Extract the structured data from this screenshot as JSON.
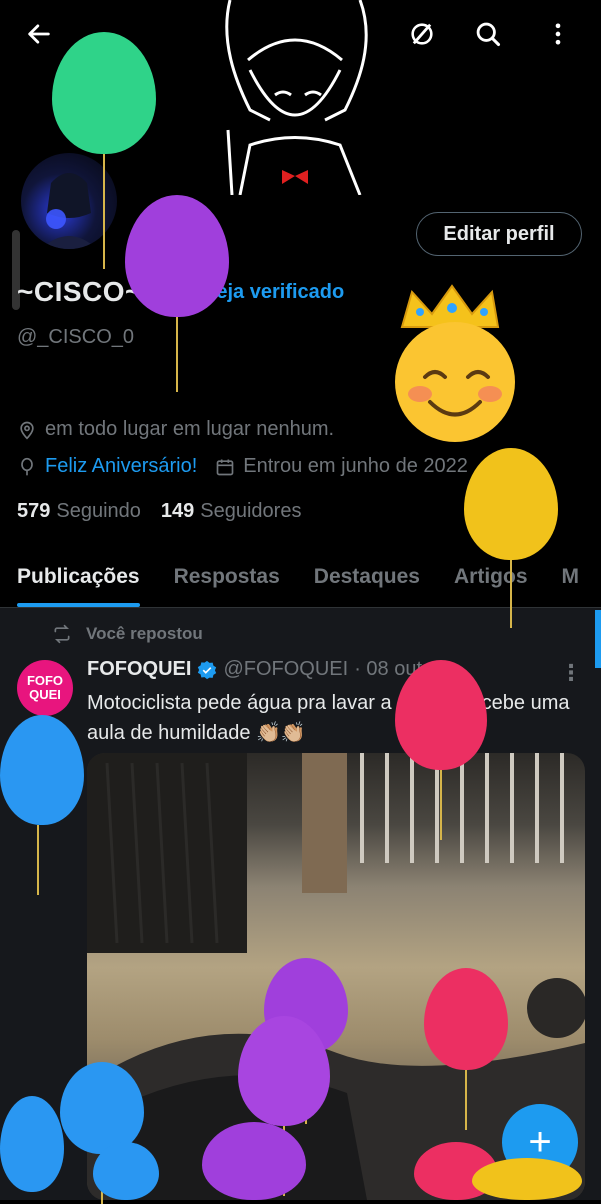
{
  "header": {
    "back_icon": "arrow-left-icon",
    "search_icon": "search-icon",
    "more_icon": "more-vertical-icon",
    "grok_icon": "grok-icon"
  },
  "profile": {
    "name": "~CISCO~",
    "verify_label": "Seja verificado",
    "handle": "@_CISCO_0",
    "edit_button": "Editar perfil",
    "location": "em todo lugar em lugar nenhum.",
    "birthday": "Feliz Aniversário!",
    "joined": "Entrou em junho de 2022",
    "following_count": "579",
    "following_label": "Seguindo",
    "followers_count": "149",
    "followers_label": "Seguidores"
  },
  "tabs": [
    {
      "label": "Publicações",
      "active": true
    },
    {
      "label": "Respostas",
      "active": false
    },
    {
      "label": "Destaques",
      "active": false
    },
    {
      "label": "Artigos",
      "active": false
    },
    {
      "label": "M",
      "active": false
    }
  ],
  "post": {
    "repost_label": "Você repostou",
    "avatar_text_1": "FOFO",
    "avatar_text_2": "QUEI",
    "display_name": "FOFOQUEI",
    "username": "@FOFOQUEI",
    "date": "· 08 out.",
    "text": "Motociclista pede água pra lavar a moto e recebe uma aula de humildade 👏🏼👏🏼"
  },
  "fab_label": "+",
  "colors": {
    "accent": "#1d9bf0",
    "background": "#000000",
    "muted": "#71767b",
    "brand_pink": "#e8157e"
  }
}
